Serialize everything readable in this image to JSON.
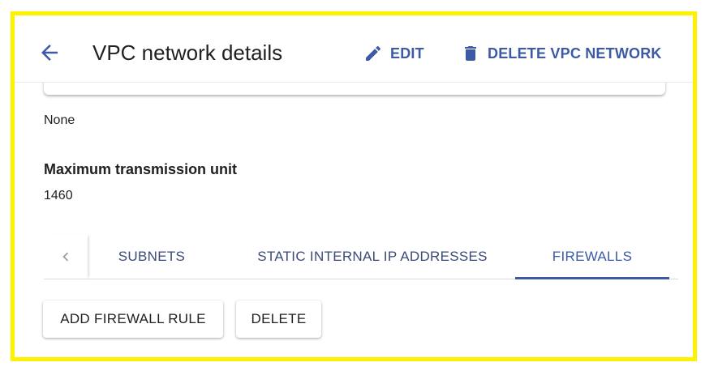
{
  "header": {
    "title": "VPC network details",
    "edit_label": "EDIT",
    "delete_label": "DELETE VPC NETWORK"
  },
  "details": {
    "previous_value": "None",
    "mtu_label": "Maximum transmission unit",
    "mtu_value": "1460"
  },
  "tabs": [
    {
      "label": "SUBNETS",
      "active": false
    },
    {
      "label": "STATIC INTERNAL IP ADDRESSES",
      "active": false
    },
    {
      "label": "FIREWALLS",
      "active": true
    }
  ],
  "actions": {
    "add_rule_label": "ADD FIREWALL RULE",
    "delete_label": "DELETE"
  },
  "colors": {
    "accent": "#3c5aa6",
    "frame_highlight": "#fff200",
    "text": "#202124"
  },
  "icons": {
    "back": "arrow-back-icon",
    "edit": "pencil-icon",
    "delete": "trash-icon",
    "tab_scroll": "chevron-left-icon"
  }
}
